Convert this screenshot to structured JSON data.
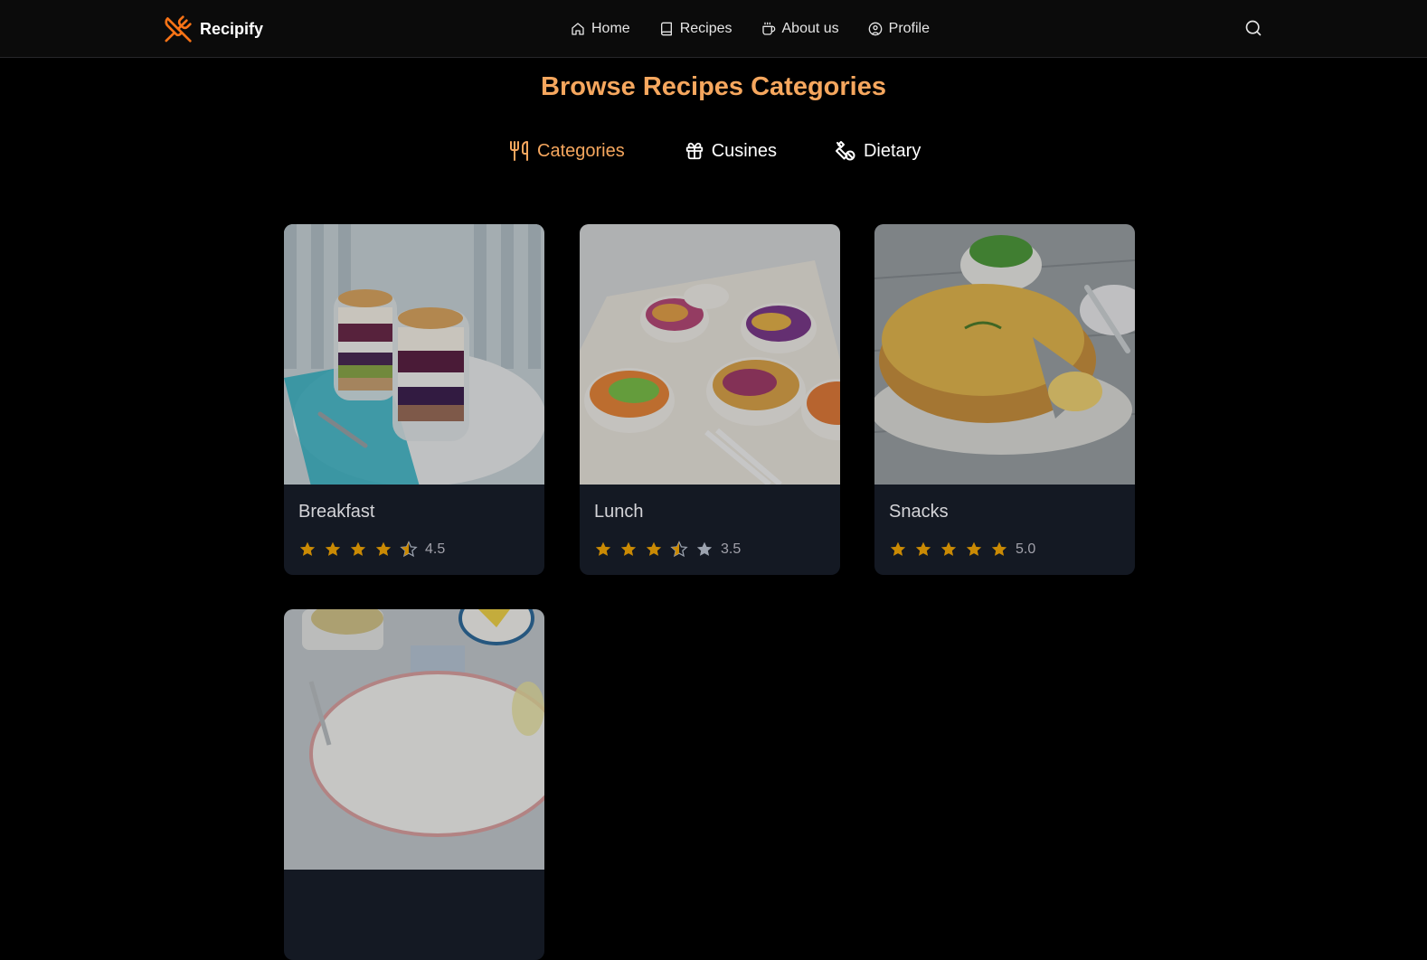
{
  "app": {
    "name": "Recipify"
  },
  "nav": {
    "items": [
      {
        "label": "Home",
        "icon": "home-icon"
      },
      {
        "label": "Recipes",
        "icon": "book-icon"
      },
      {
        "label": "About us",
        "icon": "coffee-icon"
      },
      {
        "label": "Profile",
        "icon": "user-circle-icon"
      }
    ],
    "search_icon": "search-icon"
  },
  "page": {
    "title": "Browse Recipes Categories"
  },
  "tabs": [
    {
      "label": "Categories",
      "icon": "utensils-icon",
      "active": true
    },
    {
      "label": "Cusines",
      "icon": "gift-icon",
      "active": false
    },
    {
      "label": "Dietary",
      "icon": "vegan-icon",
      "active": false
    }
  ],
  "cards": [
    {
      "title": "Breakfast",
      "rating": 4.5,
      "rating_text": "4.5",
      "image": "yogurt parfait jars photo"
    },
    {
      "title": "Lunch",
      "rating": 3.5,
      "rating_text": "3.5",
      "image": "noodle salad cups photo"
    },
    {
      "title": "Snacks",
      "rating": 5.0,
      "rating_text": "5.0",
      "image": "quiche photo"
    },
    {
      "title": "",
      "rating": null,
      "rating_text": "",
      "image": "plated fish dish photo"
    }
  ],
  "colors": {
    "accent": "#f6a75e",
    "brand_logo": "#f97316",
    "star_filled": "#ca8a04",
    "star_empty": "#9ca3af",
    "card_bg": "#141923"
  }
}
